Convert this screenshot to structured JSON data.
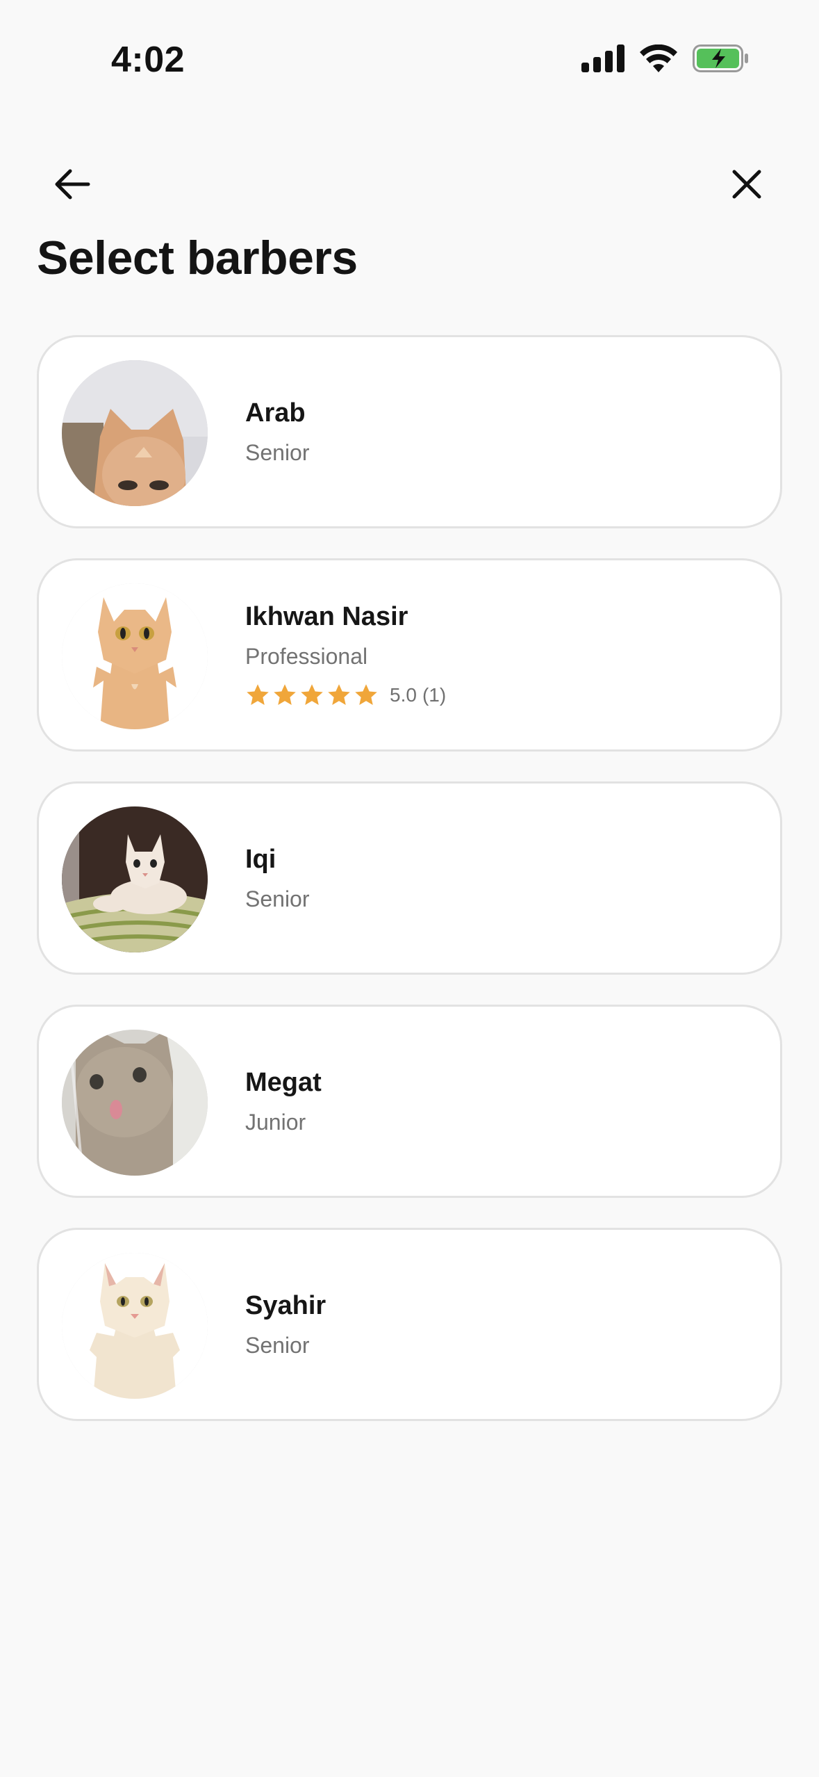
{
  "status_bar": {
    "time": "4:02",
    "signal_icon": "cellular-signal-icon",
    "wifi_icon": "wifi-icon",
    "battery_icon": "battery-charging-icon",
    "battery_color": "#55c05a"
  },
  "nav": {
    "back_icon": "arrow-left-icon",
    "close_icon": "close-icon"
  },
  "page": {
    "title": "Select barbers"
  },
  "barbers": [
    {
      "name": "Arab",
      "role": "Senior",
      "avatar_icon": "cat-photo-avatar"
    },
    {
      "name": "Ikhwan Nasir",
      "role": "Professional",
      "avatar_icon": "cat-photo-avatar",
      "rating": {
        "stars": 5,
        "max": 5,
        "value": "5.0",
        "count": "(1)"
      }
    },
    {
      "name": "Iqi",
      "role": "Senior",
      "avatar_icon": "cat-photo-avatar"
    },
    {
      "name": "Megat",
      "role": "Junior",
      "avatar_icon": "cat-photo-avatar"
    },
    {
      "name": "Syahir",
      "role": "Senior",
      "avatar_icon": "cat-photo-avatar"
    }
  ],
  "colors": {
    "background": "#f9f9f9",
    "card_background": "#ffffff",
    "card_border": "#e2e2e2",
    "star": "#f0a63a",
    "secondary_text": "#727272"
  }
}
